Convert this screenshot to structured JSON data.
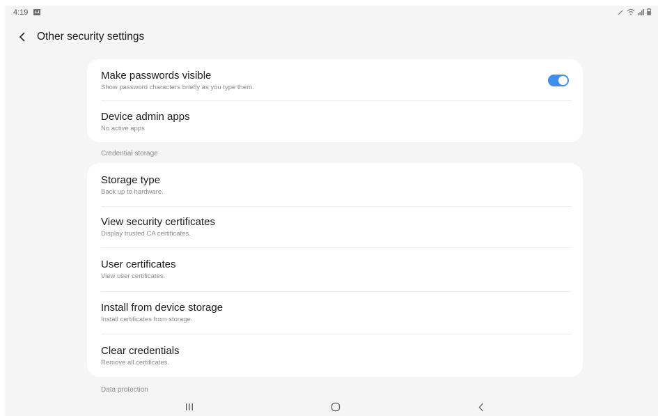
{
  "status_bar": {
    "time": "4:19",
    "icons": [
      "pen-icon",
      "wifi-icon",
      "signal-icon",
      "battery-icon"
    ]
  },
  "header": {
    "title": "Other security settings"
  },
  "card1": {
    "items": [
      {
        "title": "Make passwords visible",
        "subtitle": "Show password characters briefly as you type them.",
        "toggle_on": true
      },
      {
        "title": "Device admin apps",
        "subtitle": "No active apps"
      }
    ]
  },
  "section_credential": "Credential storage",
  "card2": {
    "items": [
      {
        "title": "Storage type",
        "subtitle": "Back up to hardware."
      },
      {
        "title": "View security certificates",
        "subtitle": "Display trusted CA certificates."
      },
      {
        "title": "User certificates",
        "subtitle": "View user certificates."
      },
      {
        "title": "Install from device storage",
        "subtitle": "Install certificates from storage."
      },
      {
        "title": "Clear credentials",
        "subtitle": "Remove all certificates."
      }
    ]
  },
  "section_data": "Data protection",
  "colors": {
    "accent": "#3e8ef0",
    "background": "#f5f5f5",
    "card": "#ffffff"
  },
  "nav_bar": {
    "buttons": [
      "recents-icon",
      "home-icon",
      "back-icon"
    ]
  }
}
